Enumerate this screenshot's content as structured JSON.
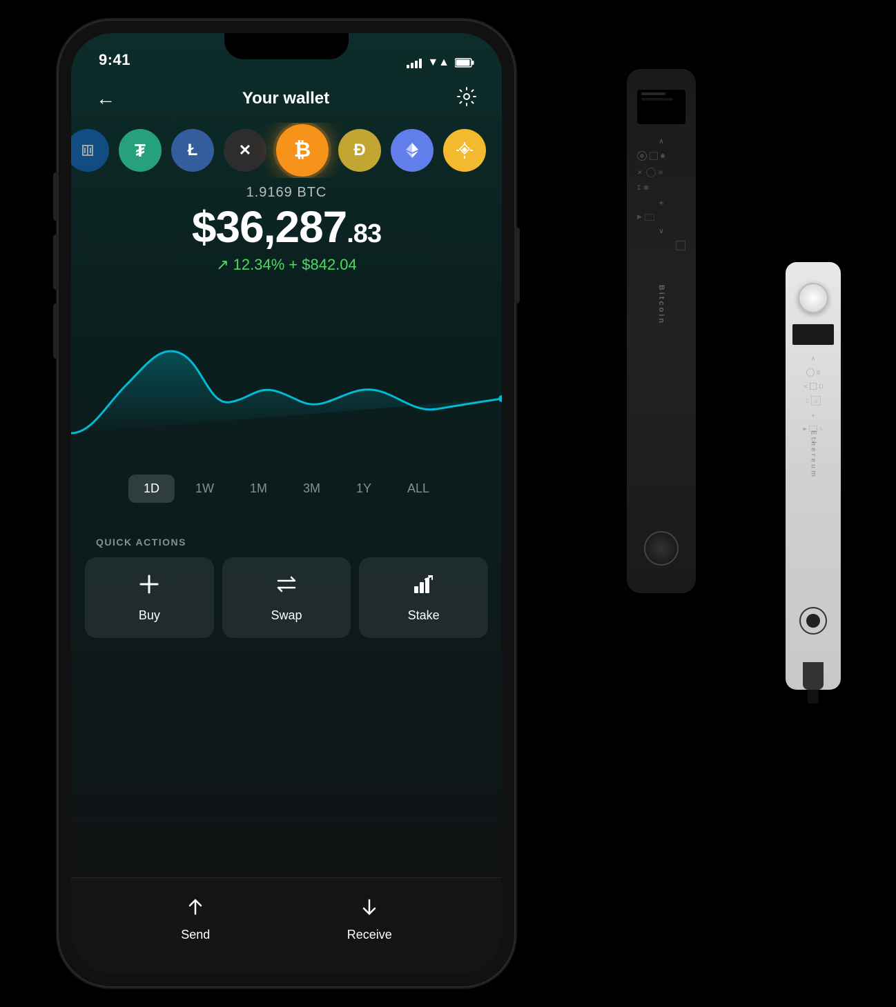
{
  "app": {
    "title": "Your wallet",
    "back_label": "←",
    "settings_label": "⚙",
    "status_time": "9:41"
  },
  "coins": [
    {
      "id": "unknown",
      "symbol": "?",
      "color": "#2196F3",
      "bg": "#1565C0"
    },
    {
      "id": "usdt",
      "symbol": "₮",
      "color": "#fff",
      "bg": "#26A17B"
    },
    {
      "id": "ltc",
      "symbol": "Ł",
      "color": "#fff",
      "bg": "#345D9D"
    },
    {
      "id": "xrp",
      "symbol": "✕",
      "color": "#fff",
      "bg": "#2d2d2d"
    },
    {
      "id": "btc",
      "symbol": "₿",
      "color": "#fff",
      "bg": "#f7931a",
      "active": true
    },
    {
      "id": "doge",
      "symbol": "Ð",
      "color": "#fff",
      "bg": "#c2a633"
    },
    {
      "id": "eth",
      "symbol": "⬡",
      "color": "#fff",
      "bg": "#627EEA"
    },
    {
      "id": "bnb",
      "symbol": "◈",
      "color": "#fff",
      "bg": "#F3BA2F"
    }
  ],
  "balance": {
    "crypto_amount": "1.9169 BTC",
    "fiat_dollars": "$36,287",
    "fiat_cents": ".83",
    "change_percent": "12.34%",
    "change_amount": "+ $842.04",
    "change_arrow": "↗"
  },
  "chart": {
    "color": "#00bcd4",
    "timeframes": [
      {
        "label": "1D",
        "active": true
      },
      {
        "label": "1W",
        "active": false
      },
      {
        "label": "1M",
        "active": false
      },
      {
        "label": "3M",
        "active": false
      },
      {
        "label": "1Y",
        "active": false
      },
      {
        "label": "ALL",
        "active": false
      }
    ]
  },
  "quick_actions": {
    "label": "QUICK ACTIONS",
    "items": [
      {
        "id": "buy",
        "label": "Buy",
        "icon": "+"
      },
      {
        "id": "swap",
        "label": "Swap",
        "icon": "⇄"
      },
      {
        "id": "stake",
        "label": "Stake",
        "icon": "↑↑"
      }
    ]
  },
  "bottom_bar": {
    "items": [
      {
        "id": "send",
        "label": "Send",
        "icon": "↑"
      },
      {
        "id": "receive",
        "label": "Receive",
        "icon": "↓"
      }
    ]
  },
  "devices": {
    "nano_x": {
      "label": "Bitcoin"
    },
    "nano_s": {
      "label": "Ethereum"
    }
  }
}
